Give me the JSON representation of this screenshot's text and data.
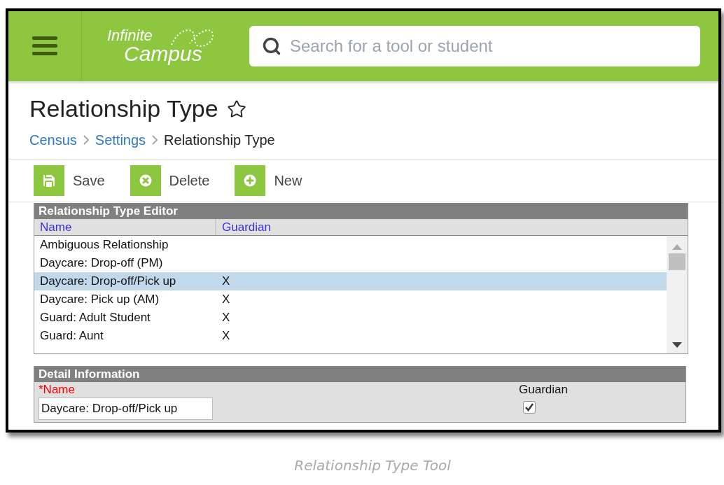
{
  "header": {
    "logo_line_1": "Infinite",
    "logo_line_2": "Campus",
    "search": {
      "placeholder": "Search for a tool or student"
    }
  },
  "page": {
    "title": "Relationship Type",
    "favorite": false,
    "breadcrumbs": [
      {
        "label": "Census",
        "kind": "link"
      },
      {
        "label": "Settings",
        "kind": "link"
      },
      {
        "label": "Relationship Type",
        "kind": "current"
      }
    ]
  },
  "toolbar": [
    {
      "label": "Save",
      "kind": "save"
    },
    {
      "label": "Delete",
      "kind": "delete"
    },
    {
      "label": "New",
      "kind": "new"
    }
  ],
  "editor": {
    "title": "Relationship Type Editor",
    "columns": [
      "Name",
      "Guardian"
    ],
    "rows": [
      {
        "name": "Ambiguous Relationship",
        "guardian": "",
        "selected": false
      },
      {
        "name": "Daycare: Drop-off (PM)",
        "guardian": "",
        "selected": false
      },
      {
        "name": "Daycare: Drop-off/Pick up",
        "guardian": "X",
        "selected": true
      },
      {
        "name": "Daycare: Pick up (AM)",
        "guardian": "X",
        "selected": false
      },
      {
        "name": "Guard: Adult Student",
        "guardian": "X",
        "selected": false
      },
      {
        "name": "Guard: Aunt",
        "guardian": "X",
        "selected": false
      }
    ]
  },
  "detail": {
    "title": "Detail Information",
    "name_label": "*Name",
    "name_value": "Daycare: Drop-off/Pick up",
    "guardian_label": "Guardian",
    "guardian_checked": true
  },
  "caption": "Relationship Type Tool"
}
